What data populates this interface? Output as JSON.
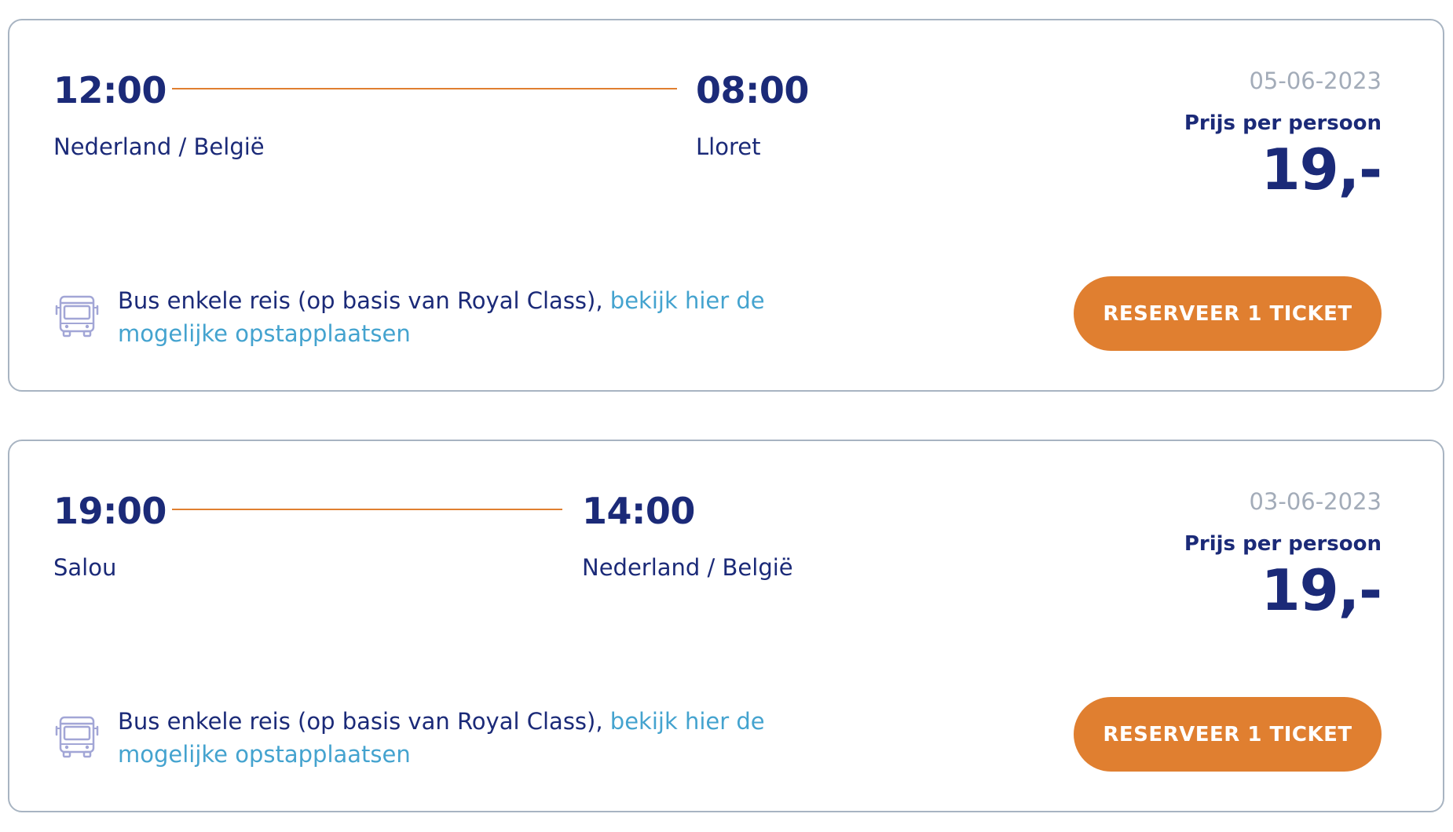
{
  "trips": [
    {
      "departure_time": "12:00",
      "departure_place": "Nederland / België",
      "arrival_time": "08:00",
      "arrival_place": "Lloret",
      "date": "05-06-2023",
      "price_label": "Prijs per persoon",
      "price": "19,-",
      "icon": "bus-icon",
      "description": "Bus enkele reis (op basis van Royal Class),",
      "link_text": "bekijk hier de mogelijke opstapplaatsen",
      "button_label": "RESERVEER 1 TICKET"
    },
    {
      "departure_time": "19:00",
      "departure_place": "Salou",
      "arrival_time": "14:00",
      "arrival_place": "Nederland / België",
      "date": "03-06-2023",
      "price_label": "Prijs per persoon",
      "price": "19,-",
      "icon": "bus-icon",
      "description": "Bus enkele reis (op basis van Royal Class),",
      "link_text": "bekijk hier de mogelijke opstapplaatsen",
      "button_label": "RESERVEER 1 TICKET"
    }
  ],
  "colors": {
    "primary_text": "#1b2a78",
    "accent_orange": "#e07f30",
    "link_blue": "#44a3cf",
    "muted_date": "#a3acb9",
    "card_border": "#a8b4c2"
  }
}
